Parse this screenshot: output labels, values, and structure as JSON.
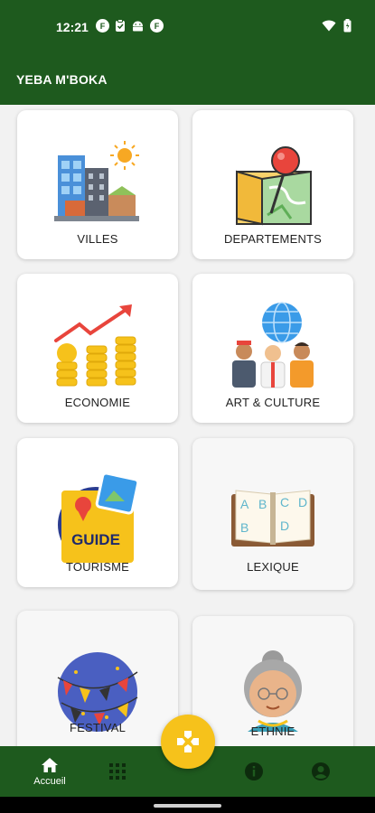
{
  "status_bar": {
    "time": "12:21",
    "left_icons": [
      "f-circle-icon",
      "clipboard-icon",
      "android-icon",
      "f-circle-icon"
    ],
    "right_icons": [
      "wifi-icon",
      "battery-icon"
    ]
  },
  "app_bar": {
    "title": "YEBA M'BOKA"
  },
  "cards": [
    {
      "label": "VILLES",
      "icon": "city-icon"
    },
    {
      "label": "DEPARTEMENTS",
      "icon": "map-pin-icon"
    },
    {
      "label": "ECONOMIE",
      "icon": "coins-growth-icon"
    },
    {
      "label": "ART & CULTURE",
      "icon": "people-globe-icon"
    },
    {
      "label": "TOURISME",
      "icon": "guide-book-icon"
    },
    {
      "label": "LEXIQUE",
      "icon": "alphabet-book-icon"
    },
    {
      "label": "FESTIVAL",
      "icon": "festival-bunting-icon"
    },
    {
      "label": "ETHNIE",
      "icon": "elder-woman-icon"
    }
  ],
  "fab": {
    "icon": "gamepad-icon"
  },
  "bottom_nav": [
    {
      "label": "Accueil",
      "icon": "home-icon",
      "active": true
    },
    {
      "label": "",
      "icon": "grid-icon"
    },
    {
      "label": "",
      "icon": "info-icon"
    },
    {
      "label": "",
      "icon": "account-icon"
    }
  ],
  "colors": {
    "primary": "#1e5a1e",
    "accent": "#f6c21b",
    "background": "#f2f2f2"
  }
}
